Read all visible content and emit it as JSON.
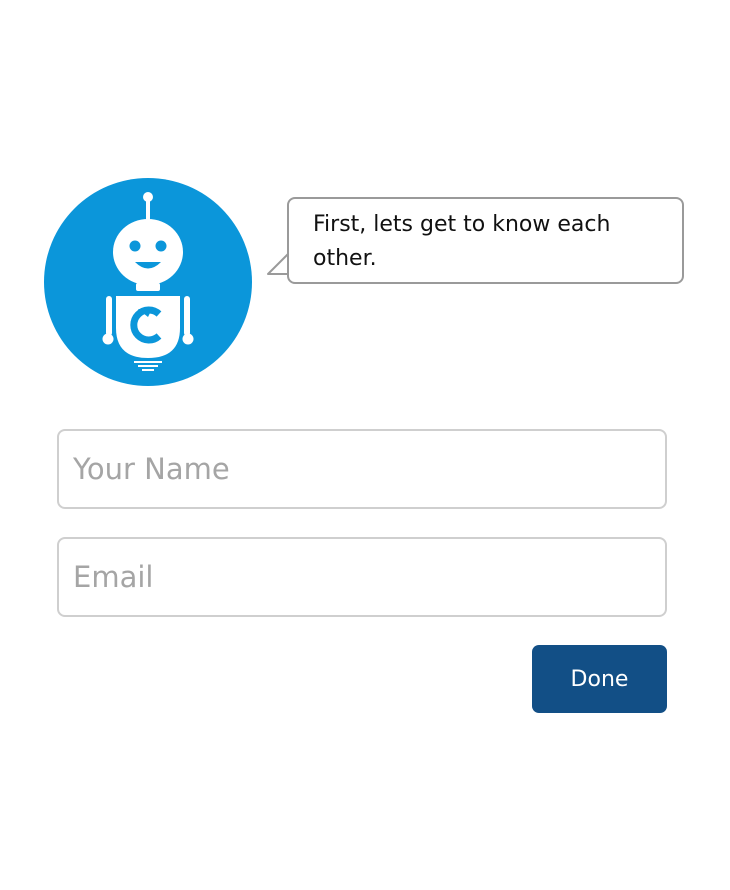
{
  "bot": {
    "icon": "robot-avatar-icon",
    "color": "#0b96da",
    "message": "First, lets get to know each other."
  },
  "form": {
    "name_placeholder": "Your Name",
    "name_value": "",
    "email_placeholder": "Email",
    "email_value": "",
    "done_label": "Done",
    "done_color": "#124f86"
  }
}
